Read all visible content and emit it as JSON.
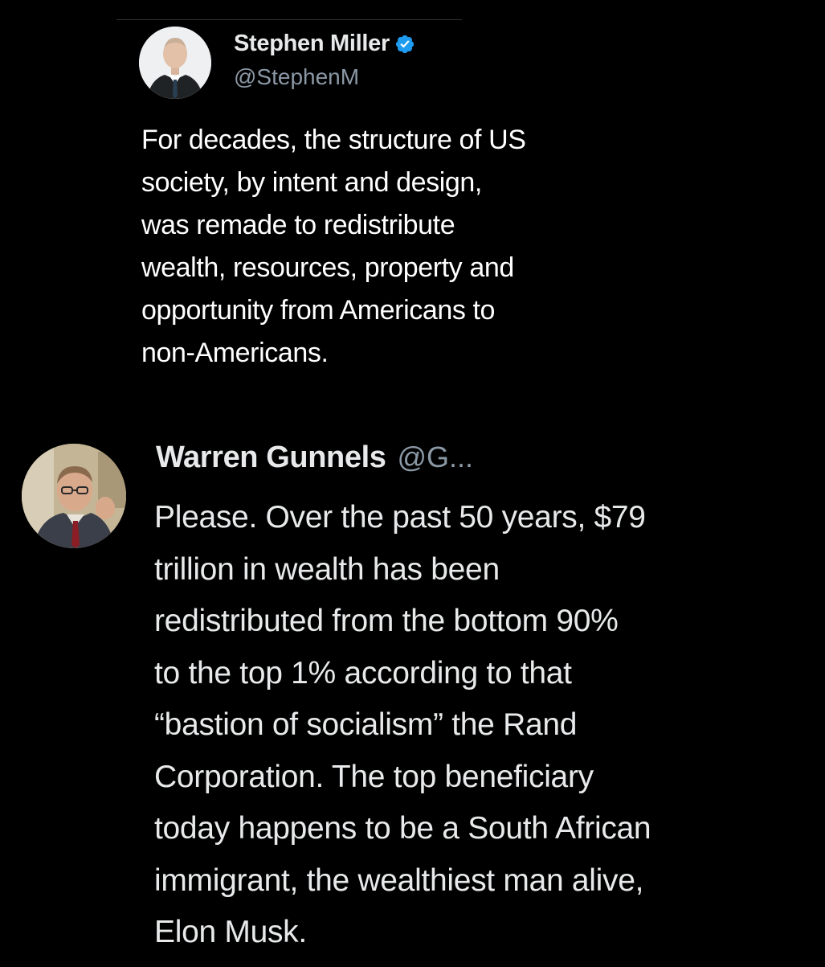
{
  "colors": {
    "background": "#000000",
    "primary_text": "#e7e9ea",
    "secondary_text": "#8b98a5",
    "verified_badge": "#1d9bf0"
  },
  "tweet_main": {
    "display_name": "Stephen Miller",
    "handle": "@StephenM",
    "verified_icon": "verified-badge-icon",
    "avatar_icon": "avatar",
    "text": "For decades, the structure of US\nsociety, by intent and design,\nwas remade to redistribute\nwealth, resources, property and\nopportunity from Americans to\nnon-Americans."
  },
  "tweet_reply": {
    "display_name": "Warren Gunnels",
    "handle": "@G...",
    "avatar_icon": "avatar",
    "text": "Please. Over the past 50 years, $79\ntrillion in wealth has been\nredistributed from the bottom 90%\nto the top 1% according to that\n“bastion of socialism” the Rand\nCorporation. The top beneficiary\ntoday happens to be a South African\nimmigrant, the wealthiest man alive,\nElon Musk."
  }
}
